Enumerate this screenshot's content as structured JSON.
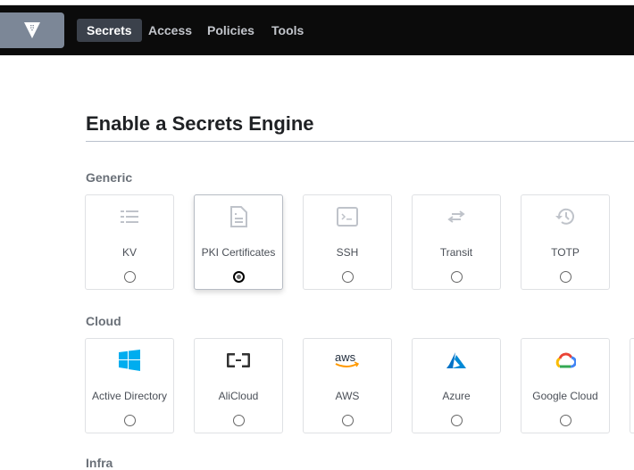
{
  "nav": {
    "items": [
      {
        "label": "Secrets",
        "active": true
      },
      {
        "label": "Access"
      },
      {
        "label": "Policies"
      },
      {
        "label": "Tools"
      }
    ]
  },
  "page": {
    "title": "Enable a Secrets Engine"
  },
  "sections": [
    {
      "title": "Generic",
      "engines": [
        {
          "label": "KV",
          "icon": "list-icon",
          "selected": false
        },
        {
          "label": "PKI Certificates",
          "icon": "document-icon",
          "selected": true
        },
        {
          "label": "SSH",
          "icon": "terminal-icon",
          "selected": false
        },
        {
          "label": "Transit",
          "icon": "swap-arrows-icon",
          "selected": false
        },
        {
          "label": "TOTP",
          "icon": "history-clock-icon",
          "selected": false
        }
      ]
    },
    {
      "title": "Cloud",
      "engines": [
        {
          "label": "Active Directory",
          "icon": "windows-logo-icon",
          "selected": false
        },
        {
          "label": "AliCloud",
          "icon": "alicloud-logo-icon",
          "selected": false
        },
        {
          "label": "AWS",
          "icon": "aws-logo-icon",
          "selected": false
        },
        {
          "label": "Azure",
          "icon": "azure-logo-icon",
          "selected": false
        },
        {
          "label": "Google Cloud",
          "icon": "google-cloud-logo-icon",
          "selected": false
        }
      ]
    },
    {
      "title": "Infra"
    }
  ]
}
